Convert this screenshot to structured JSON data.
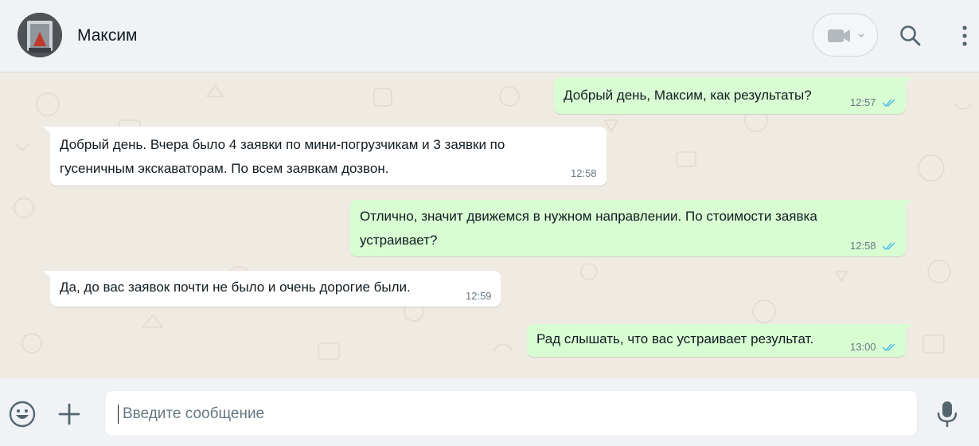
{
  "header": {
    "contact_name": "Максим",
    "icons": [
      "avatar",
      "video-call-icon",
      "chevron-down-icon",
      "search-icon",
      "menu-icon"
    ]
  },
  "messages": [
    {
      "direction": "outgoing",
      "lines": [
        "Добрый день, Максим, как результаты?"
      ],
      "time": "12:57",
      "status": "read"
    },
    {
      "direction": "incoming",
      "lines": [
        "Добрый день. Вчера было 4 заявки по мини-погрузчикам и 3 заявки по",
        "гусеничным экскаваторам. По всем заявкам дозвон."
      ],
      "time": "12:58"
    },
    {
      "direction": "outgoing",
      "lines": [
        "Отлично, значит движемся в нужном направлении. По стоимости заявка",
        "устраивает?"
      ],
      "time": "12:58",
      "status": "read"
    },
    {
      "direction": "incoming",
      "lines": [
        "Да, до вас заявок почти не было и очень дорогие были."
      ],
      "time": "12:59"
    },
    {
      "direction": "outgoing",
      "lines": [
        "Рад слышать, что вас устраивает результат."
      ],
      "time": "13:00",
      "status": "read"
    }
  ],
  "composer": {
    "placeholder": "Введите сообщение",
    "icons": [
      "emoji-icon",
      "plus-icon",
      "microphone-icon"
    ]
  },
  "colors": {
    "outgoing_bubble": "#d9fdd3",
    "incoming_bubble": "#ffffff",
    "chat_background": "#efeae2",
    "read_ticks": "#53bdeb",
    "header_background": "#f0f2f5"
  }
}
